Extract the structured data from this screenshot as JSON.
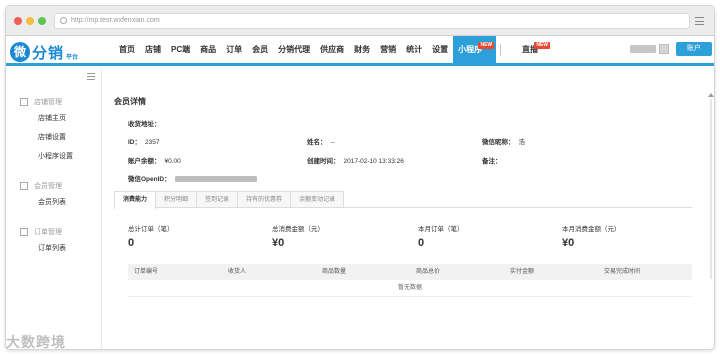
{
  "browser": {
    "url": "http://mp.test.wxfenxian.com"
  },
  "logo": {
    "wei": "微",
    "name": "分销",
    "sub": "平台"
  },
  "nav": {
    "items": [
      "首页",
      "店铺",
      "PC端",
      "商品",
      "订单",
      "会员",
      "分销代理",
      "供应商",
      "财务",
      "营销",
      "统计",
      "设置"
    ],
    "active": "小程序",
    "new_badge": "NEW",
    "live": "直播",
    "account": "账户"
  },
  "sidebar": {
    "groups": [
      {
        "title": "店铺管理",
        "icon": "home-icon",
        "items": [
          "店铺主页",
          "店铺设置",
          "小程序设置"
        ]
      },
      {
        "title": "会员管理",
        "icon": "users-icon",
        "items": [
          "会员列表"
        ]
      },
      {
        "title": "订单管理",
        "icon": "order-icon",
        "items": [
          "订单列表"
        ]
      }
    ]
  },
  "member": {
    "title": "会员详情",
    "address_label": "收货地址：",
    "id_label": "ID：",
    "id_value": "2357",
    "name_label": "姓名：",
    "name_value": "--",
    "nickname_label": "微信昵称：",
    "nickname_value": "浩",
    "balance_label": "账户余额：",
    "balance_value": "¥0.00",
    "created_label": "创建时间：",
    "created_value": "2017-02-10 13:33:26",
    "note_label": "备注：",
    "openid_label": "微信OpenID："
  },
  "tabs": [
    "消费能力",
    "积分明细",
    "签到记录",
    "持有的优惠券",
    "余额变动记录"
  ],
  "stats": [
    {
      "label": "总计订单（笔）",
      "value": "0"
    },
    {
      "label": "总消费金额（元）",
      "value": "¥0"
    },
    {
      "label": "本月订单（笔）",
      "value": "0"
    },
    {
      "label": "本月消费金额（元）",
      "value": "¥0"
    }
  ],
  "table": {
    "columns": [
      "订单编号",
      "收货人",
      "商品数量",
      "商品总价",
      "实付金额",
      "交易完成时间"
    ],
    "empty": "暂无数据"
  },
  "watermark": "大数跨境",
  "colors": {
    "accent": "#2d9fd9",
    "badge": "#e8482f"
  }
}
